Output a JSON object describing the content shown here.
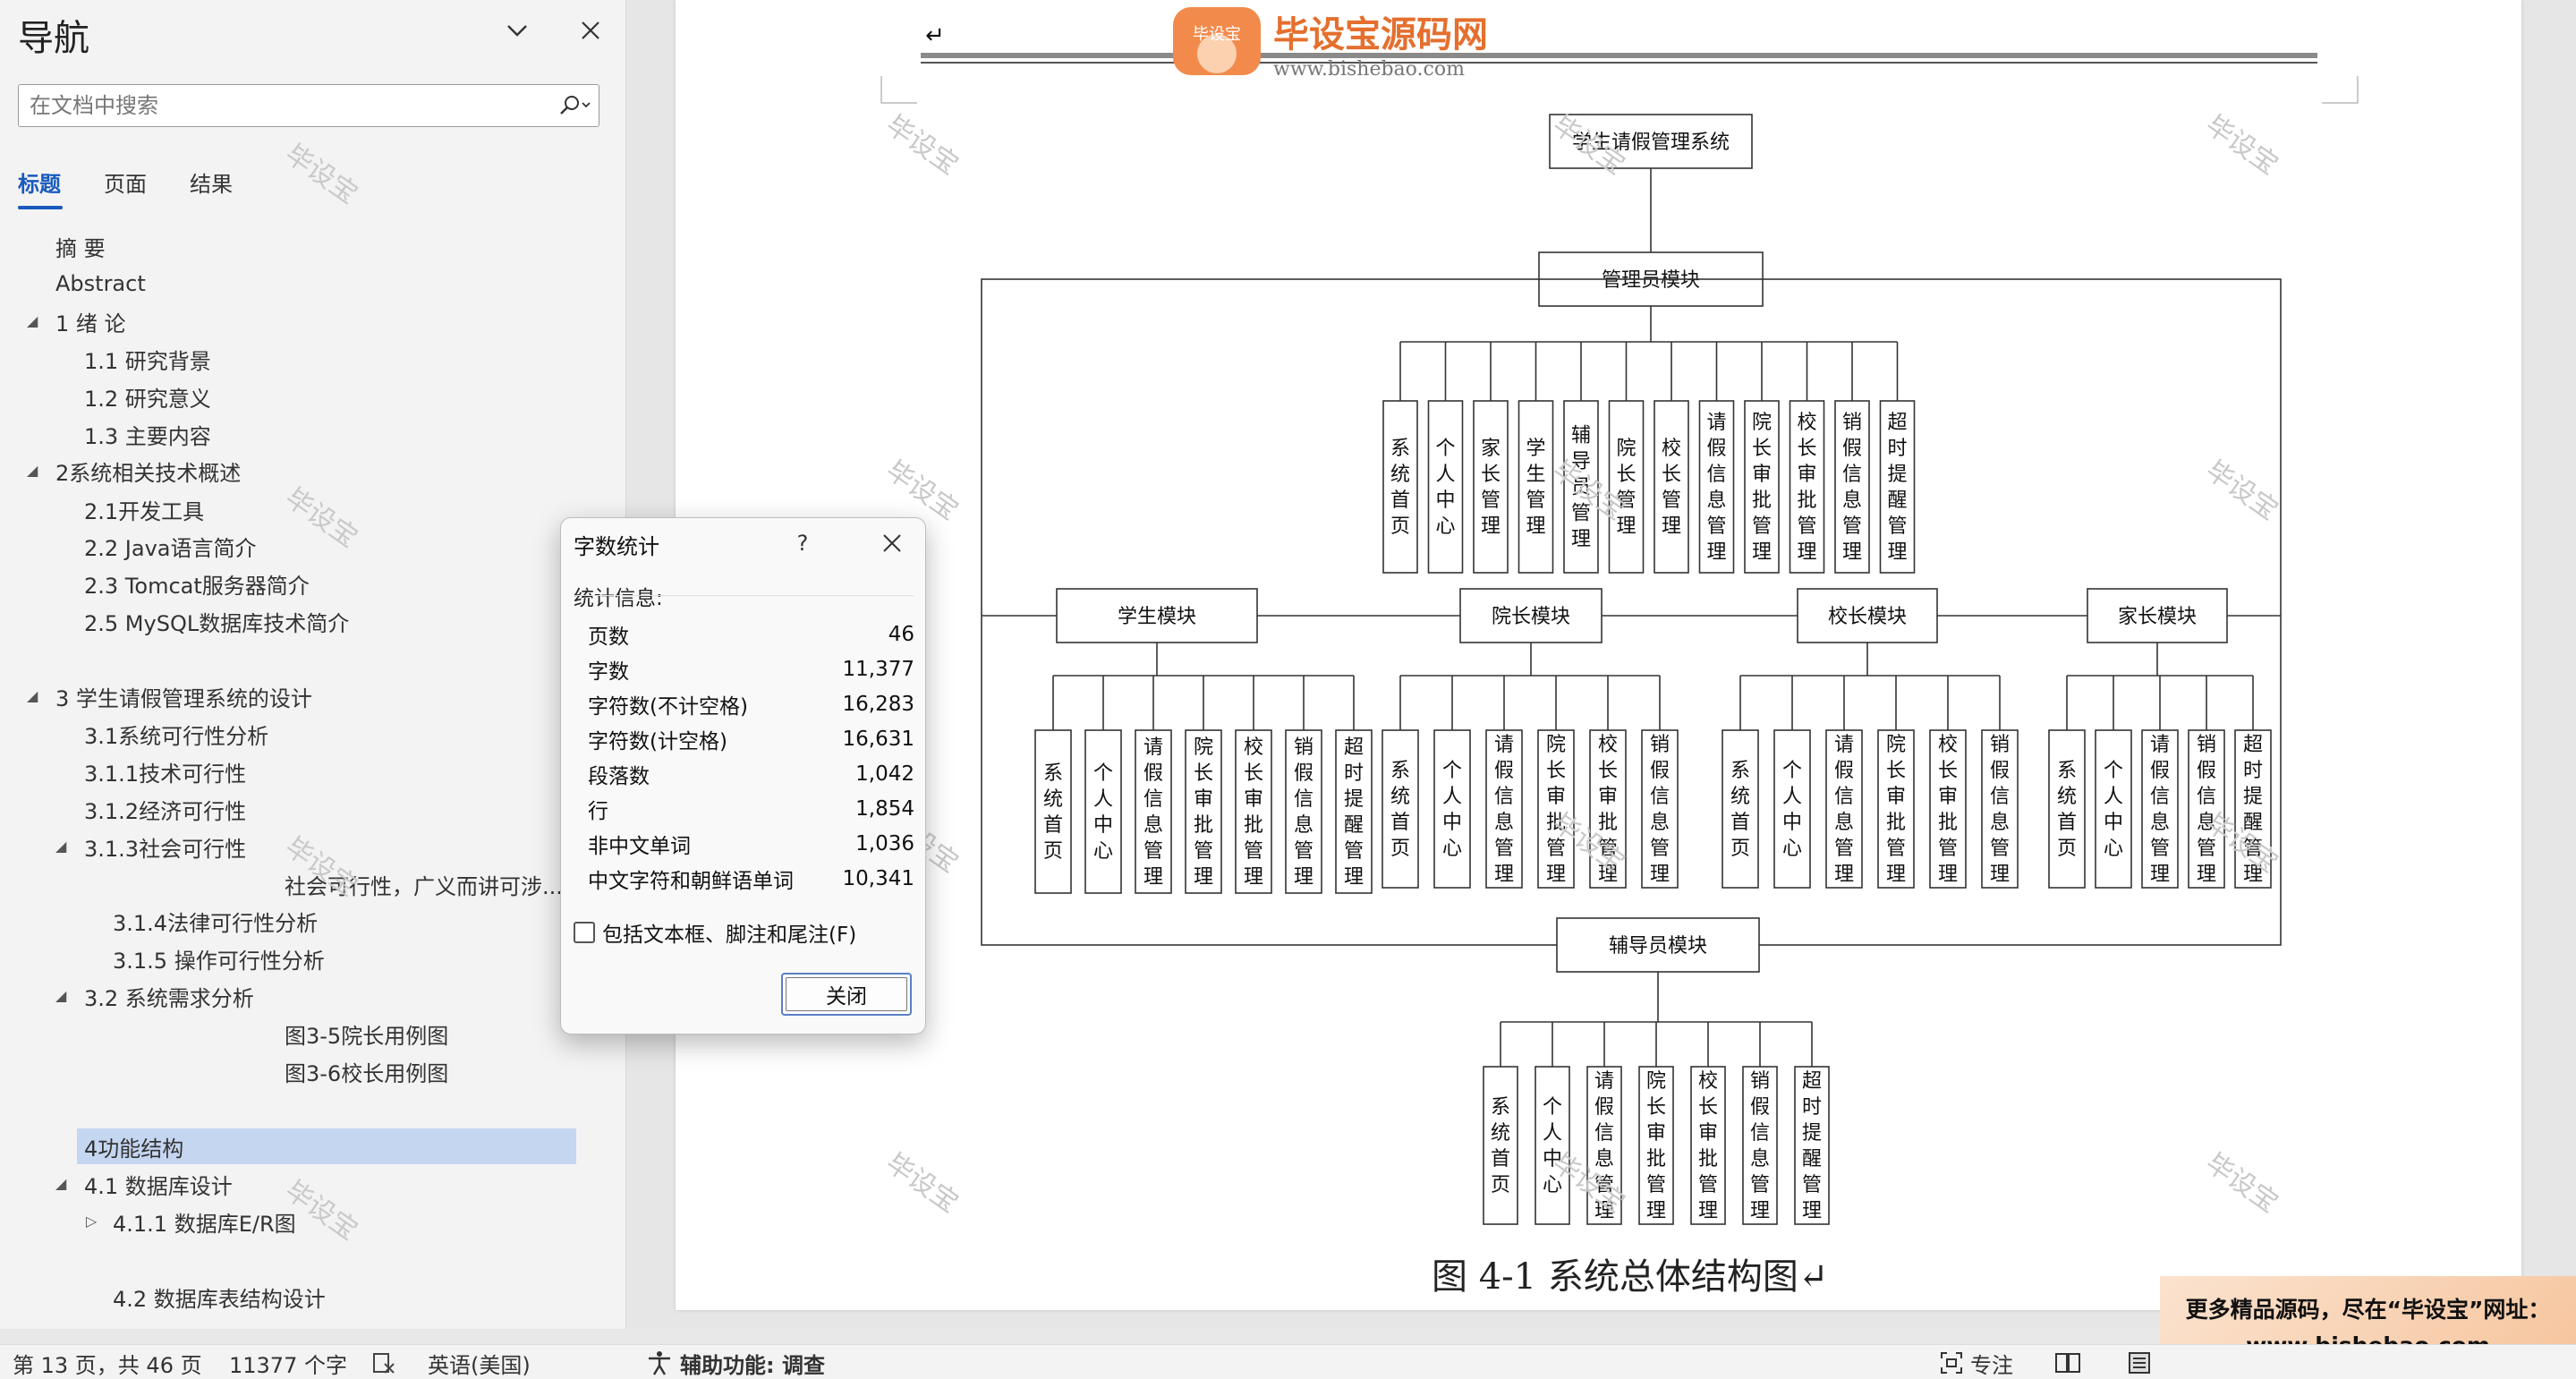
{
  "nav": {
    "title": "导航",
    "search_placeholder": "在文档中搜索",
    "tabs": [
      "标题",
      "页面",
      "结果"
    ],
    "items": [
      {
        "label": "摘  要",
        "level": 0,
        "expand": ""
      },
      {
        "label": "Abstract",
        "level": 0,
        "expand": ""
      },
      {
        "label": "1 绪  论",
        "level": 0,
        "expand": "◢"
      },
      {
        "label": "1.1 研究背景",
        "level": 1,
        "expand": ""
      },
      {
        "label": "1.2 研究意义",
        "level": 1,
        "expand": ""
      },
      {
        "label": "1.3 主要内容",
        "level": 1,
        "expand": ""
      },
      {
        "label": "2系统相关技术概述",
        "level": 0,
        "expand": "◢"
      },
      {
        "label": "2.1开发工具",
        "level": 1,
        "expand": ""
      },
      {
        "label": "2.2 Java语言简介",
        "level": 1,
        "expand": ""
      },
      {
        "label": "2.3 Tomcat服务器简介",
        "level": 1,
        "expand": ""
      },
      {
        "label": "2.5 MySQL数据库技术简介",
        "level": 1,
        "expand": ""
      },
      {
        "label": "3 学生请假管理系统的设计",
        "level": 0,
        "expand": "◢"
      },
      {
        "label": "3.1系统可行性分析",
        "level": 1,
        "expand": ""
      },
      {
        "label": "3.1.1技术可行性",
        "level": 1,
        "expand": ""
      },
      {
        "label": "3.1.2经济可行性",
        "level": 1,
        "expand": ""
      },
      {
        "label": "3.1.3社会可行性",
        "level": 1,
        "expand": "◢"
      },
      {
        "label": "社会可行性，广义而讲可涉...",
        "level": 3,
        "expand": ""
      },
      {
        "label": "3.1.4法律可行性分析",
        "level": 2,
        "expand": ""
      },
      {
        "label": "3.1.5 操作可行性分析",
        "level": 2,
        "expand": ""
      },
      {
        "label": "3.2 系统需求分析",
        "level": 1,
        "expand": "◢"
      },
      {
        "label": "图3-5院长用例图",
        "level": 3,
        "expand": ""
      },
      {
        "label": "图3-6校长用例图",
        "level": 3,
        "expand": ""
      },
      {
        "label": "4功能结构",
        "level": 1,
        "expand": ""
      },
      {
        "label": "4.1 数据库设计",
        "level": 1,
        "expand": "◢"
      },
      {
        "label": "4.1.1 数据库E/R图",
        "level": 2,
        "expand": "▷"
      },
      {
        "label": "4.2 数据库表结构设计",
        "level": 2,
        "expand": ""
      }
    ]
  },
  "dialog": {
    "title": "字数统计",
    "help": "?",
    "section": "统计信息:",
    "stats": [
      {
        "label": "页数",
        "value": "46"
      },
      {
        "label": "字数",
        "value": "11,377"
      },
      {
        "label": "字符数(不计空格)",
        "value": "16,283"
      },
      {
        "label": "字符数(计空格)",
        "value": "16,631"
      },
      {
        "label": "段落数",
        "value": "1,042"
      },
      {
        "label": "行",
        "value": "1,854"
      },
      {
        "label": "非中文单词",
        "value": "1,036"
      },
      {
        "label": "中文字符和朝鲜语单词",
        "value": "10,341"
      }
    ],
    "checkbox_label": "包括文本框、脚注和尾注(F)",
    "close_label": "关闭"
  },
  "document": {
    "logo_text": "毕设宝源码网",
    "logo_badge": "毕设宝",
    "logo_url": "www.bishebao.com",
    "watermark": "毕设宝",
    "caption": "图 4-1  系统总体结构图↵",
    "return_mark": "↵",
    "diagram": {
      "root": "学生请假管理系统",
      "admin": {
        "name": "管理员模块",
        "children": [
          "系统首页",
          "个人中心",
          "家长管理",
          "学生管理",
          "辅导员管理",
          "院长管理",
          "校长管理",
          "请假信息管理",
          "院长审批管理",
          "校长审批管理",
          "销假信息管理",
          "超时提醒管理"
        ]
      },
      "row2": [
        {
          "name": "学生模块",
          "children": [
            "系统首页",
            "个人中心",
            "请假信息管理",
            "院长审批管理",
            "校长审批管理",
            "销假信息管理",
            "超时提醒管理"
          ]
        },
        {
          "name": "院长模块",
          "children": [
            "系统首页",
            "个人中心",
            "请假信息管理",
            "院长审批管理",
            "校长审批管理",
            "销假信息管理"
          ]
        },
        {
          "name": "校长模块",
          "children": [
            "系统首页",
            "个人中心",
            "请假信息管理",
            "院长审批管理",
            "校长审批管理",
            "销假信息管理"
          ]
        },
        {
          "name": "家长模块",
          "children": [
            "系统首页",
            "个人中心",
            "请假信息管理",
            "销假信息管理",
            "超时提醒管理"
          ]
        }
      ],
      "counselor": {
        "name": "辅导员模块",
        "children": [
          "系统首页",
          "个人中心",
          "请假信息管理",
          "院长审批管理",
          "校长审批管理",
          "销假信息管理",
          "超时提醒管理"
        ]
      }
    }
  },
  "ad": {
    "line1": "更多精品源码，尽在“毕设宝”网址：",
    "line2": "www.bishebao.com"
  },
  "status": {
    "page": "第 13 页，共 46 页",
    "words": "11377 个字",
    "lang": "英语(美国)",
    "accessibility": "辅助功能: 调查",
    "focus": "专注"
  }
}
